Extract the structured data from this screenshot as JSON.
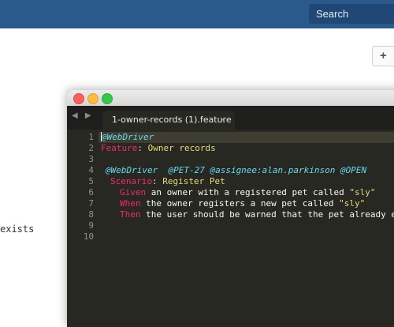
{
  "topbar": {
    "search_placeholder": "Search"
  },
  "page": {
    "add_button_label": "+",
    "background_text": "exists"
  },
  "editor": {
    "tab_title": "1-owner-records (1).feature",
    "tab_close": "×",
    "nav_arrows": "◀ ▶",
    "line_numbers": [
      "1",
      "2",
      "3",
      "4",
      "5",
      "6",
      "7",
      "8",
      "9",
      "10"
    ],
    "lines": {
      "l1": {
        "tag": "@WebDriver"
      },
      "l2": {
        "kw": "Feature",
        "rest": ": Owner records"
      },
      "l4": {
        "tags": "@WebDriver  @PET-27 @assignee:alan.parkinson @OPEN"
      },
      "l5": {
        "kw": "Scenario",
        "rest": ": Register Pet"
      },
      "l6": {
        "kw": "Given",
        "text": " an owner with a registered pet called ",
        "str": "\"sly\""
      },
      "l7": {
        "kw": "When",
        "text": " the owner registers a new pet called ",
        "str": "\"sly\""
      },
      "l8": {
        "kw": "Then",
        "text": " the user should be warned that the pet already exists"
      }
    },
    "colors": {
      "background": "#272822",
      "keyword": "#f92672",
      "tag": "#66d9ef",
      "string": "#e6db74"
    }
  }
}
